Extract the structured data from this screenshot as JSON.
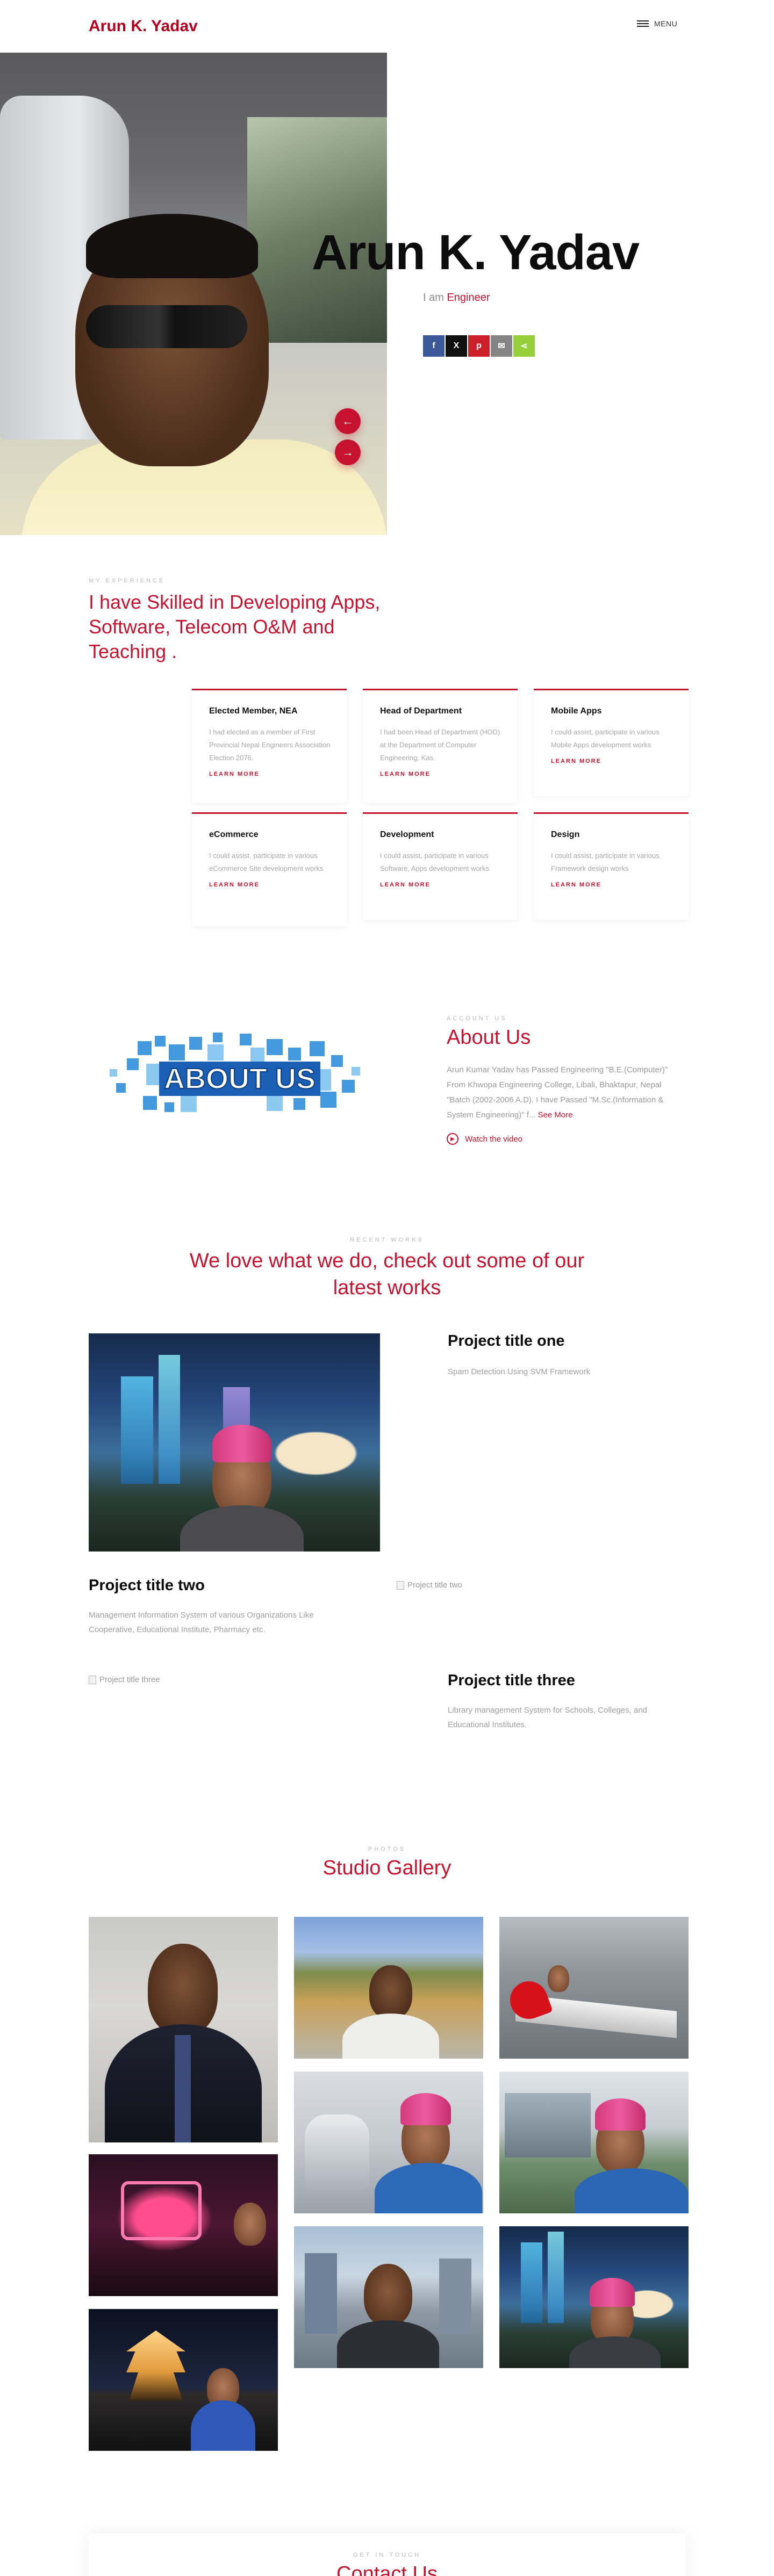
{
  "header": {
    "logo": "Arun K. Yadav",
    "menu_label": "MENU"
  },
  "hero": {
    "name": "Arun K. Yadav",
    "role_prefix": "I am",
    "role_word": "Engineer",
    "share_buttons": [
      {
        "icon": "facebook-icon",
        "glyph": "f",
        "color": "#3b5998"
      },
      {
        "icon": "x-icon",
        "glyph": "X",
        "color": "#111111"
      },
      {
        "icon": "pinterest-icon",
        "glyph": "p",
        "color": "#cb2027"
      },
      {
        "icon": "email-icon",
        "glyph": "✉",
        "color": "#848484"
      },
      {
        "icon": "share-icon",
        "glyph": "⋖",
        "color": "#95d03a"
      }
    ],
    "prev_arrow": "←",
    "next_arrow": "→"
  },
  "experience": {
    "kicker": "MY EXPERIENCE",
    "title": "I have Skilled in Developing Apps, Software, Telecom O&M and Teaching .",
    "cards": [
      {
        "title": "Elected Member, NEA",
        "text": "I had elected as a member of First Provincial Nepal Engineers Association Election 2076.",
        "more": "LEARN MORE"
      },
      {
        "title": "Head of Department",
        "text": "I had been Head of Department (HOD) at the Department of Computer Engineering, Kas.",
        "more": "LEARN MORE"
      },
      {
        "title": "Mobile Apps",
        "text": "I could assist, participate in various Mobile Apps development works",
        "more": "LEARN MORE"
      },
      {
        "title": "eCommerce",
        "text": "I could assist, participate in various eCommerce Site development works",
        "more": "LEARN MORE"
      },
      {
        "title": "Development",
        "text": "I could assist, participate in various Software, Apps development works",
        "more": "LEARN MORE"
      },
      {
        "title": "Design",
        "text": "I could assist, participate in various Framework design works",
        "more": "LEARN MORE"
      }
    ]
  },
  "about": {
    "kicker": "ACCOUNT US",
    "graphic_text": "ABOUT US",
    "title": "About Us",
    "text": "Arun Kumar Yadav has Passed Engineering \"B.E.(Computer)\" From Khwopa Engineering College, Libali, Bhaktapur, Nepal \"Batch (2002-2006 A.D). I have Passed \"M.Sc.(Information & System Engineering)\" f...",
    "see_more": "See More",
    "watch": "Watch the video"
  },
  "works": {
    "kicker": "RECENT WORKS",
    "title": "We love what we do, check out some of our latest works",
    "projects": [
      {
        "title": "Project title one",
        "desc": "Spam Detection Using SVM Framework"
      },
      {
        "title": "Project title two",
        "desc": "Management Information System of various Organizations Like Cooperative, Educational Institute, Pharmacy etc.",
        "img_alt": "Project title two"
      },
      {
        "title": "Project title three",
        "desc": "Library management System for Schools, Colleges, and Educational Institutes.",
        "img_alt": "Project title three"
      }
    ]
  },
  "gallery": {
    "kicker": "PHOTOS",
    "title": "Studio Gallery"
  },
  "contact": {
    "kicker": "GET IN TOUCH",
    "title": "Contact Us"
  },
  "colors": {
    "accent": "#c4122f",
    "muted": "#a8a8a8",
    "dark": "#0c0c0c"
  }
}
